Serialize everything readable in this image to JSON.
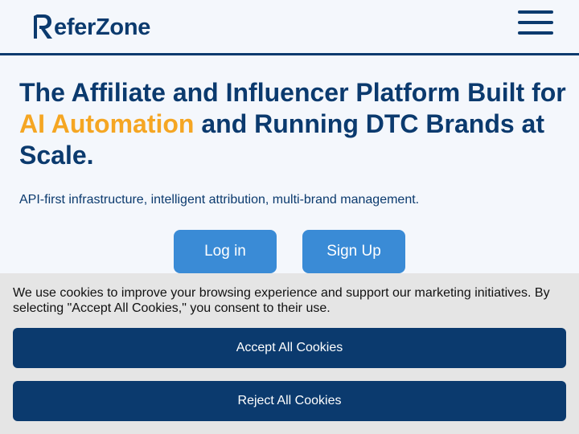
{
  "header": {
    "logo_text": "eferZone",
    "logo_alt": "ReferZone",
    "menu_icon": "hamburger-menu-icon"
  },
  "hero": {
    "title_part1": "The Affiliate and Influencer Platform Built for ",
    "title_accent": "AI Automation",
    "title_part2": " and Running DTC Brands at Scale.",
    "subtitle": "API-first infrastructure, intelligent attribution, multi-brand management.",
    "login_label": "Log in",
    "signup_label": "Sign Up"
  },
  "cookie": {
    "message": "We use cookies to improve your browsing experience and support our marketing initiatives. By selecting \"Accept All Cookies,\" you consent to their use.",
    "accept_label": "Accept All Cookies",
    "reject_label": "Reject All Cookies"
  },
  "colors": {
    "brand_navy": "#0b3a6e",
    "accent_orange": "#f5a623",
    "button_blue": "#3a8bd6",
    "page_background": "#f4f7fc",
    "cookie_background": "#e5e5e5"
  }
}
